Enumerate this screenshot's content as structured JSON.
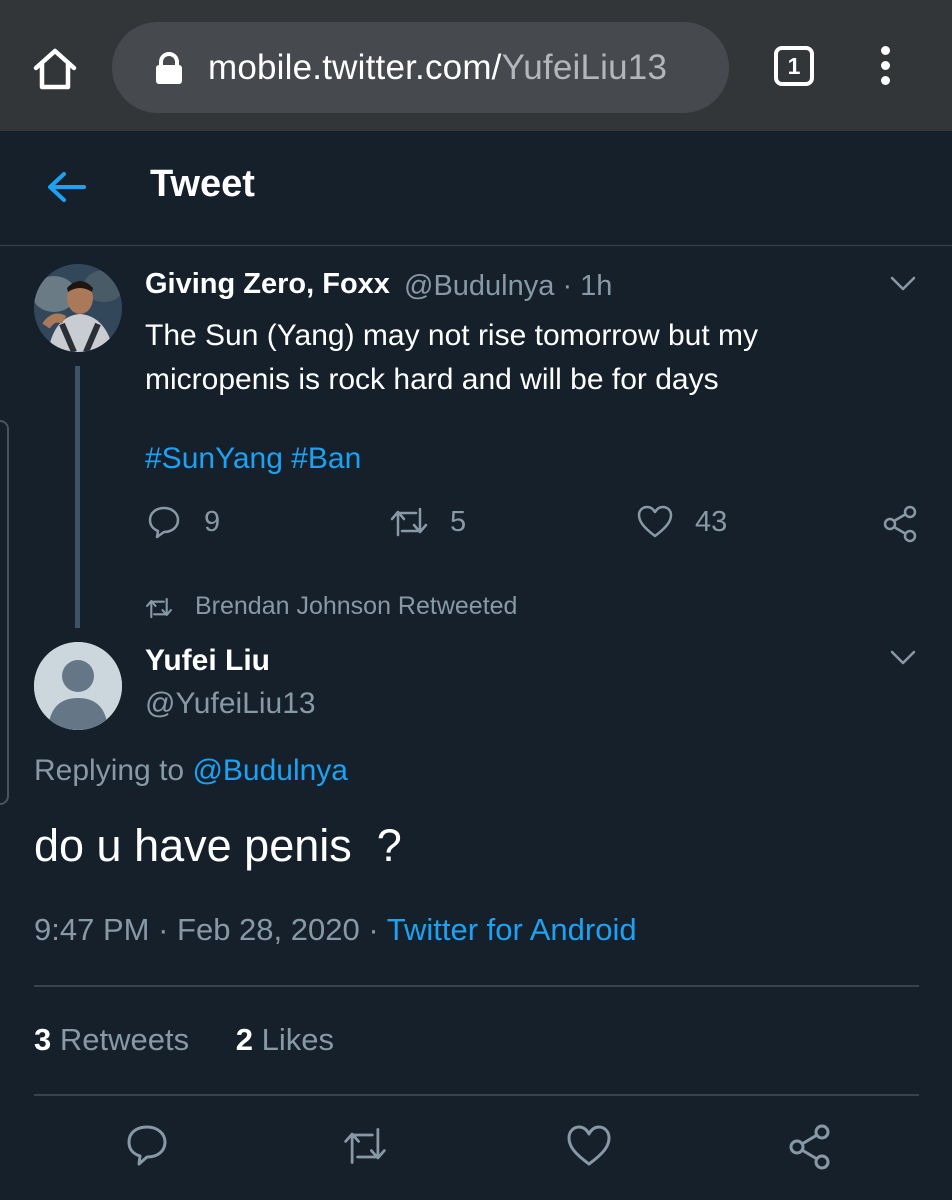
{
  "browser": {
    "url_host": "mobile.twitter.com/",
    "url_path": "YufeiLiu13",
    "tab_count": "1"
  },
  "header": {
    "title": "Tweet"
  },
  "parent_tweet": {
    "display_name": "Giving Zero, Foxx",
    "handle": "@Budulnya",
    "separator": "·",
    "time": "1h",
    "text": "The Sun (Yang) may not rise tomorrow but my micropenis is rock hard and will be for days",
    "hashtags": "#SunYang #Ban",
    "reply_count": "9",
    "retweet_count": "5",
    "like_count": "43"
  },
  "retweet_context": {
    "text": "Brendan Johnson Retweeted"
  },
  "main_tweet": {
    "display_name": "Yufei Liu",
    "handle": "@YufeiLiu13",
    "replying_label": "Replying to",
    "replying_to": "@Budulnya",
    "text": "do u have penis  ?",
    "time": "9:47 PM",
    "sep1": "·",
    "date": "Feb 28, 2020",
    "sep2": "·",
    "source": "Twitter for Android",
    "retweets_count": "3",
    "retweets_label": "Retweets",
    "likes_count": "2",
    "likes_label": "Likes"
  },
  "colors": {
    "background": "#15202b",
    "accent": "#1da1f2",
    "secondary_text": "#8899a6",
    "chrome": "#333639"
  }
}
